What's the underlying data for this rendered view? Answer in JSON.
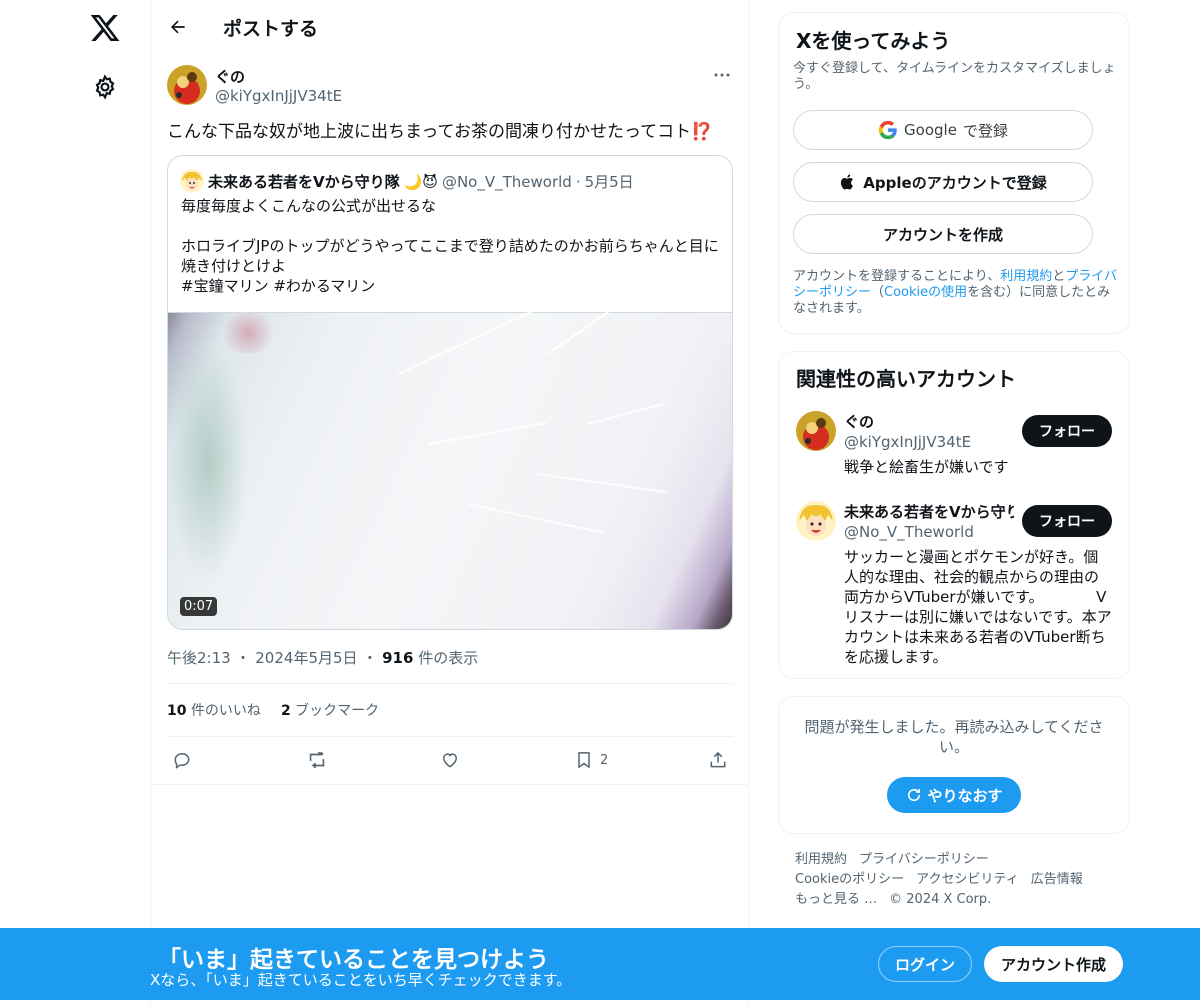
{
  "nav": {
    "logo_icon": "x-logo-icon",
    "settings_icon": "gear-icon"
  },
  "header": {
    "title": "ポストする",
    "back_icon": "arrow-left-icon"
  },
  "post": {
    "author_name": "ぐの",
    "author_handle": "@kiYgxInJjJV34tE",
    "text": "こんな下品な奴が地上波に出ちまってお茶の間凍り付かせたってコト",
    "text_emoji": "⁉️",
    "time": "午後2:13",
    "date": "2024年5月5日",
    "views_count": "916",
    "views_label": "件の表示",
    "likes_count": "10",
    "likes_label": "件のいいね",
    "bookmarks_count": "2",
    "bookmarks_label": "ブックマーク",
    "action_bookmark_count": "2"
  },
  "quoted": {
    "author_name": "未来ある若者をVから守り隊",
    "author_emoji": "🌙😈",
    "author_handle": "@No_V_Theworld",
    "separator": "·",
    "date": "5月5日",
    "text": "毎度毎度よくこんなの公式が出せるな\n\nホロライブJPのトップがどうやってここまで登り詰めたのかお前らちゃんと目に焼き付けとけよ\n #宝鐘マリン  #わかるマリン",
    "video_duration": "0:07"
  },
  "sidebar": {
    "signup": {
      "title": "Xを使ってみよう",
      "subtitle": "今すぐ登録して、タイムラインをカスタマイズしましょう。",
      "google_brand": "Google",
      "google_suffix": "で登録",
      "apple_button": "Appleのアカウントで登録",
      "create_button": "アカウントを作成",
      "terms_prefix": "アカウントを登録することにより、",
      "terms_link": "利用規約",
      "terms_and": "と",
      "privacy_link": "プライバシーポリシー",
      "cookie_open": "（",
      "cookie_link": "Cookieの使用",
      "cookie_close": "を含む）に同意したとみなされます。"
    },
    "recommendations": {
      "title": "関連性の高いアカウント",
      "follow_label": "フォロー",
      "items": [
        {
          "name": "ぐの",
          "handle": "@kiYgxInJjJV34tE",
          "bio": "戦争と絵畜生が嫌いです"
        },
        {
          "name": "未来ある若者をVから守り隊",
          "handle": "@No_V_Theworld",
          "bio": "サッカーと漫画とポケモンが好き。個人的な理由、社会的観点からの理由の両方からVTuberが嫌いです。　　　　Vリスナーは別に嫌いではないです。本アカウントは未来ある若者のVTuber断ちを応援します。"
        }
      ]
    },
    "error": {
      "message": "問題が発生しました。再読み込みしてください。",
      "retry_label": "やりなおす"
    },
    "footer": {
      "links": [
        "利用規約",
        "プライバシーポリシー",
        "Cookieのポリシー",
        "アクセシビリティ",
        "広告情報",
        "もっと見る …"
      ],
      "copyright": "© 2024 X Corp."
    }
  },
  "bottom_bar": {
    "title": "「いま」起きていることを見つけよう",
    "subtitle": "Xなら、「いま」起きていることをいち早くチェックできます。",
    "login_label": "ログイン",
    "signup_label": "アカウント作成"
  },
  "colors": {
    "accent": "#1d9bf0",
    "text": "#0f1419",
    "muted": "#536471",
    "border": "#eff3f4"
  }
}
